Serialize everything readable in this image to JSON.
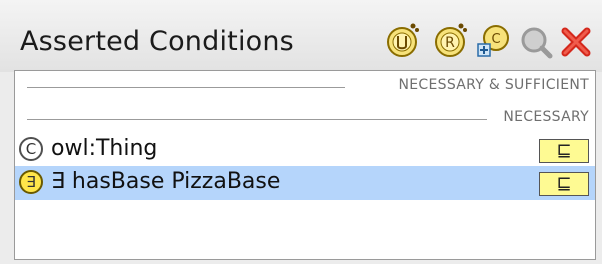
{
  "panel": {
    "title": "Asserted Conditions"
  },
  "toolbar": {
    "buttons": [
      {
        "name": "add-named-superclass-icon"
      },
      {
        "name": "add-restriction-icon"
      },
      {
        "name": "create-new-expression-icon"
      },
      {
        "name": "find-usage-icon"
      },
      {
        "name": "delete-condition-icon"
      }
    ]
  },
  "sections": {
    "necessary_sufficient": "NECESSARY & SUFFICIENT",
    "necessary": "NECESSARY"
  },
  "conditions": [
    {
      "badge": "C",
      "text": "owl:Thing",
      "op": "⊑",
      "selected": false
    },
    {
      "badge": "∃",
      "text": "∃ hasBase PizzaBase",
      "op": "⊑",
      "selected": true
    }
  ],
  "colors": {
    "selection": "#b5d5fb",
    "operator_box": "#fefa93"
  }
}
